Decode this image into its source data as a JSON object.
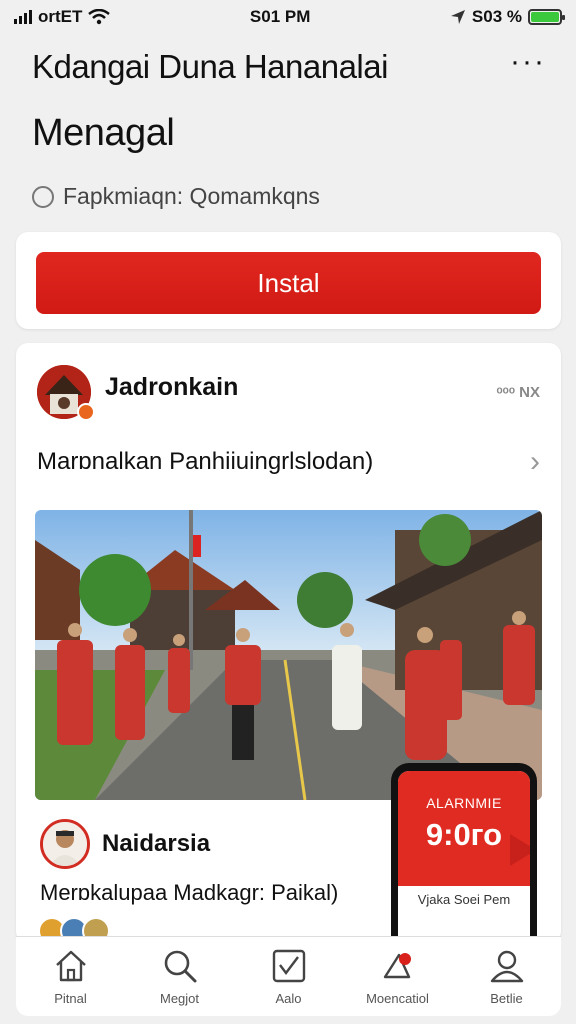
{
  "status_bar": {
    "carrier": "ortET",
    "time": "S01 PM",
    "battery_text": "S03 %",
    "icons": [
      "signal-icon",
      "wifi-icon",
      "location-arrow-icon",
      "battery-icon"
    ]
  },
  "header": {
    "title": "Kdangai Duna Hananalai",
    "subtitle": "Menagal",
    "meta_label": "Fapkmiaqn: Qomamkqns"
  },
  "install": {
    "label": "Instal"
  },
  "post1": {
    "author": "Jadronkain",
    "meta": "ᵒᵒᵒ  NX",
    "description": "Marɒnalkan Panhiiuingrlslodan)"
  },
  "post2": {
    "author": "Naidarsia",
    "description": "Merɒkalupaa Madkagr: Paikal)"
  },
  "phone_promo": {
    "label": "ALARNMIE",
    "time": "9:0го",
    "caption": "Vjaka Soei Pem"
  },
  "tabs": [
    {
      "label": "Pitnal",
      "icon": "home-icon"
    },
    {
      "label": "Megjot",
      "icon": "search-icon"
    },
    {
      "label": "Aalo",
      "icon": "chart-icon"
    },
    {
      "label": "Moencatiol",
      "icon": "notification-icon"
    },
    {
      "label": "Betlie",
      "icon": "profile-icon"
    }
  ],
  "colors": {
    "accent_red": "#d8211a",
    "background": "#f0f0f0",
    "card": "#ffffff"
  }
}
